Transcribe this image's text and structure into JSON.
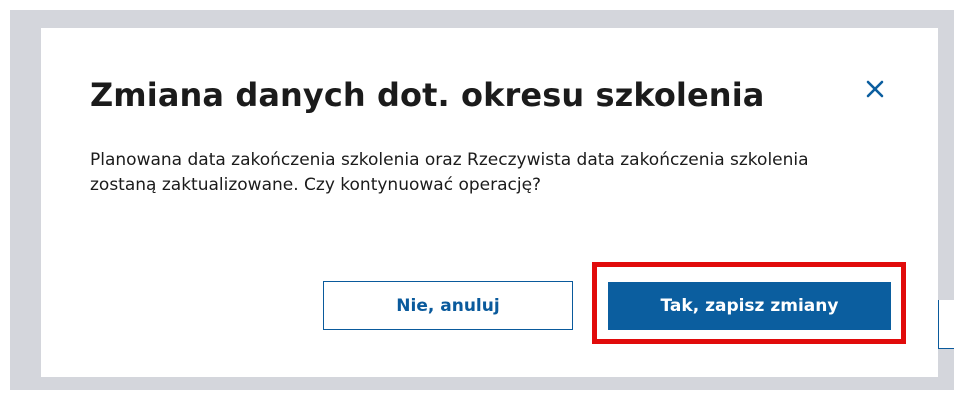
{
  "dialog": {
    "title": "Zmiana danych dot. okresu szkolenia",
    "message": "Planowana data zakończenia szkolenia oraz Rzeczywista data zakończenia szkolenia zostaną zaktualizowane. Czy kontynuować operację?",
    "close_icon": "close-icon",
    "cancel_label": "Nie, anuluj",
    "confirm_label": "Tak, zapisz zmiany"
  },
  "colors": {
    "primary": "#0b5e9f",
    "backdrop": "#d4d6dc",
    "text": "#1b1b1b",
    "highlight": "#e10b0b"
  }
}
